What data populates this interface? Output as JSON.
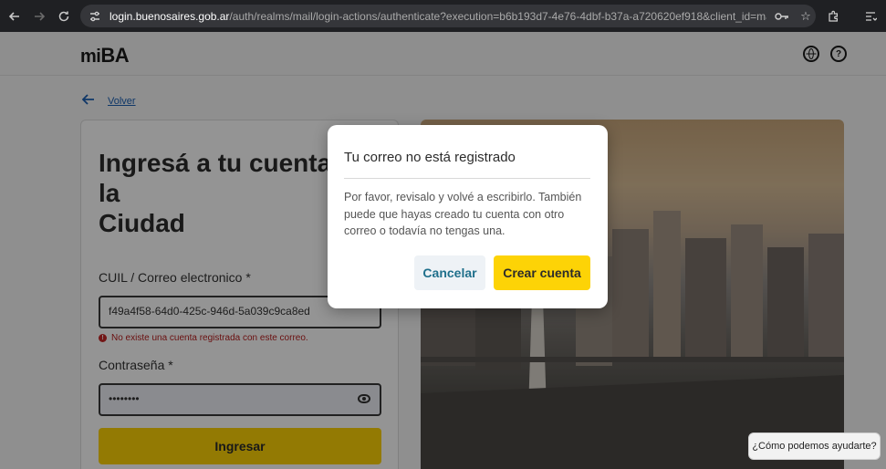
{
  "browser": {
    "url_host": "login.buenosaires.gob.ar",
    "url_path": "/auth/realms/mail/login-actions/authenticate?execution=b6b193d7-4e76-4dbf-b37a-a720620ef918&client_id=mail-idp&tab_id=..."
  },
  "header": {
    "logo_prefix": "mi",
    "logo_suffix": "BA"
  },
  "back": {
    "label": "Volver"
  },
  "login": {
    "title": "Ingresá a tu cuenta de la\nCiudad",
    "cuil_label": "CUIL / Correo electronico *",
    "cuil_value": "f49a4f58-64d0-425c-946d-5a039c9ca8ed",
    "error": "No existe una cuenta registrada con este correo.",
    "password_label": "Contraseña *",
    "password_value": "••••••••",
    "submit_label": "Ingresar"
  },
  "modal": {
    "title": "Tu correo no está registrado",
    "body": "Por favor, revisalo y volvé a escribirlo. También puede que hayas creado tu cuenta con otro correo o todavía no tengas una.",
    "cancel_label": "Cancelar",
    "create_label": "Crear cuenta"
  },
  "help": {
    "label": "¿Cómo podemos ayudarte?"
  },
  "colors": {
    "accent_yellow": "#fdd306",
    "link_blue": "#1a5fb4",
    "error_red": "#b71c1c"
  }
}
